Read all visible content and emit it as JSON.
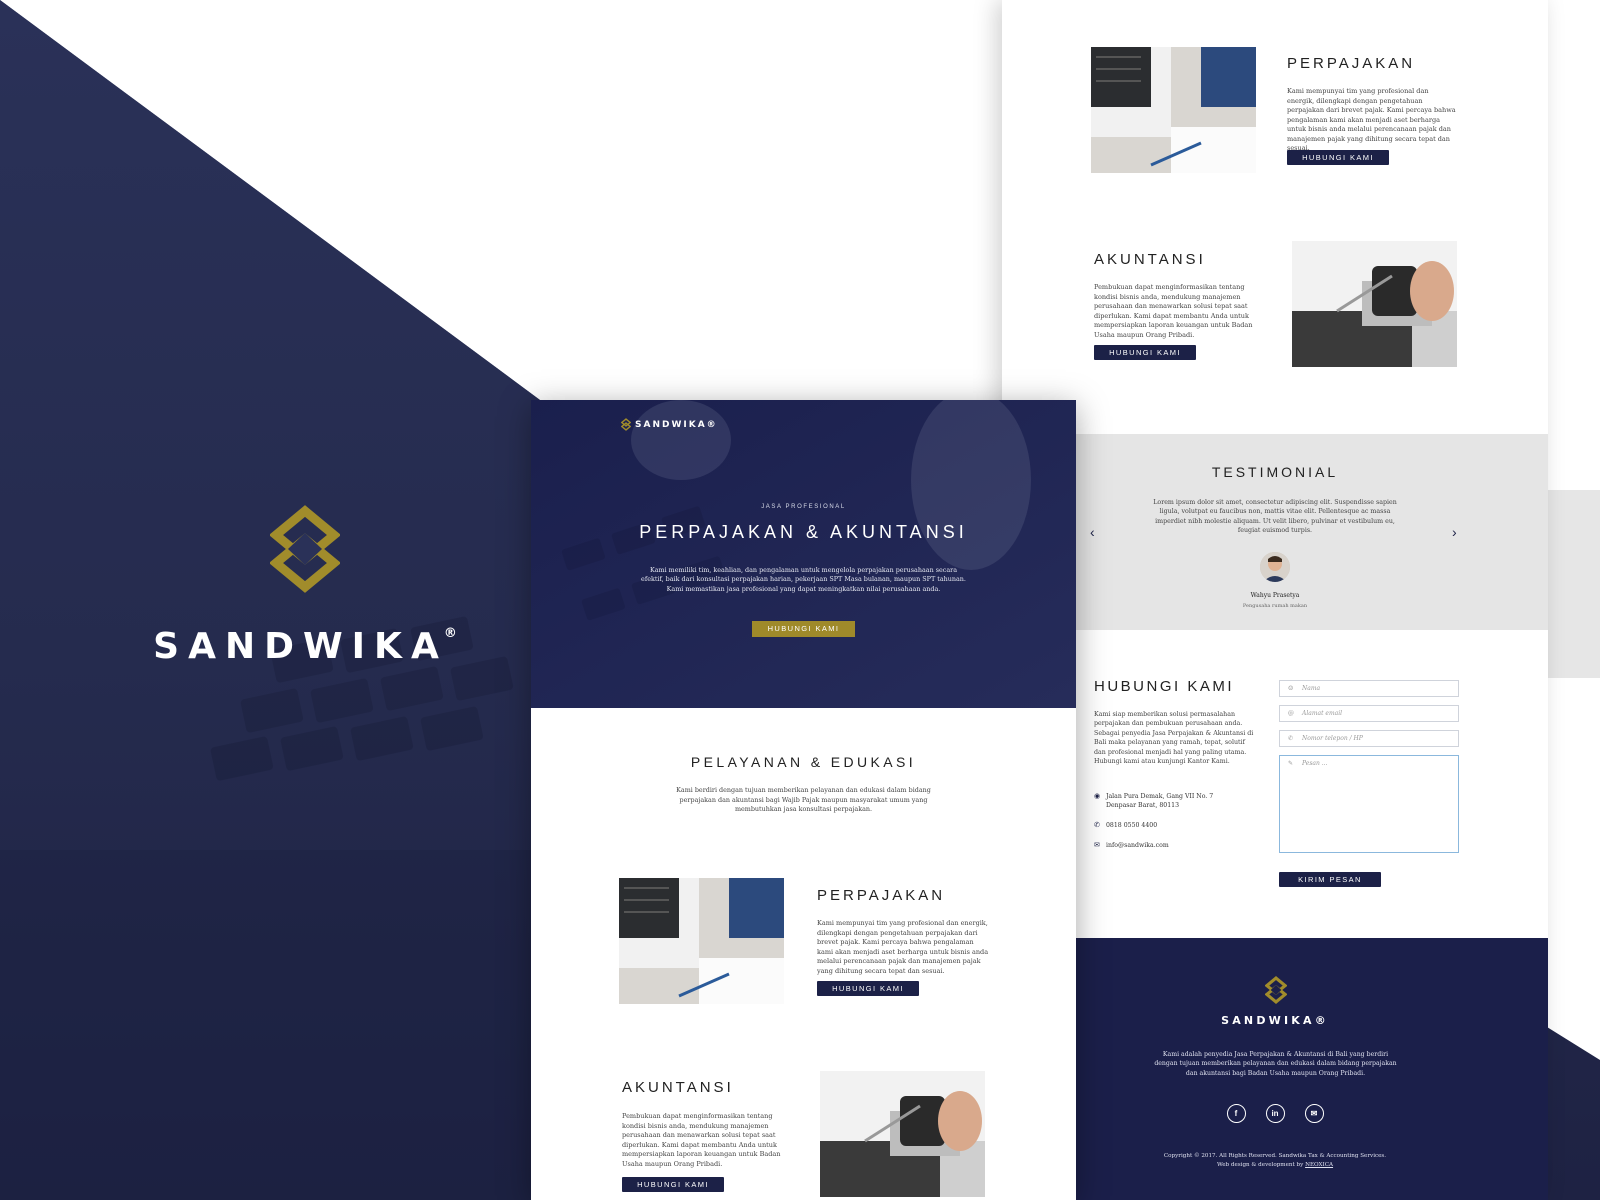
{
  "brand": {
    "name": "SANDWIKA",
    "registered": "®"
  },
  "colors": {
    "navy": "#1b2150",
    "gold": "#9f8a2a",
    "gray_section": "#e5e5e5"
  },
  "hero": {
    "logo_text": "SANDWIKA®",
    "kicker": "JASA PROFESIONAL",
    "title": "PERPAJAKAN & AKUNTANSI",
    "subtitle": "Kami memiliki tim, keahlian, dan pengalaman untuk mengelola perpajakan perusahaan secara efektif, baik dari konsultasi perpajakan harian, pekerjaan SPT Masa bulanan, maupun SPT tahunan. Kami memastikan jasa profesional yang dapat meningkatkan nilai perusahaan anda.",
    "cta": "HUBUNGI KAMI"
  },
  "services_intro": {
    "title": "PELAYANAN & EDUKASI",
    "text": "Kami berdiri dengan tujuan memberikan pelayanan dan edukasi dalam bidang perpajakan dan akuntansi bagi Wajib Pajak maupun masyarakat umum yang membutuhkan jasa konsultasi perpajakan."
  },
  "services": [
    {
      "title": "PERPAJAKAN",
      "text": "Kami mempunyai tim yang profesional dan energik, dilengkapi dengan pengetahuan perpajakan dari brevet pajak. Kami percaya bahwa pengalaman kami akan menjadi aset berharga untuk bisnis anda melalui perencanaan pajak dan manajemen pajak yang dihitung secara tepat dan sesuai.",
      "button": "HUBUNGI KAMI"
    },
    {
      "title": "AKUNTANSI",
      "text": "Pembukuan dapat menginformasikan tentang kondisi bisnis anda, mendukung manajemen perusahaan dan menawarkan solusi tepat saat diperlukan. Kami dapat membantu Anda untuk mempersiapkan laporan keuangan untuk Badan Usaha maupun Orang Pribadi.",
      "button": "HUBUNGI KAMI"
    }
  ],
  "testimonial": {
    "title": "TESTIMONIAL",
    "text": "Lorem ipsum dolor sit amet, consectetur adipiscing elit. Suspendisse sapien ligula, volutpat eu faucibus non, mattis vitae elit. Pellentesque ac massa imperdiet nibh molestie aliquam. Ut velit libero, pulvinar et vestibulum eu, feugiat euismod turpis.",
    "prev": "‹",
    "next": "›",
    "name": "Wahyu Prasetya",
    "role": "Pengusaha rumah makan"
  },
  "contact": {
    "title": "HUBUNGI KAMI",
    "text": "Kami siap memberikan solusi permasalahan perpajakan dan pembukuan perusahaan anda. Sebagai penyedia Jasa Perpajakan & Akuntansi di Bali maka pelayanan yang ramah, tepat, solutif dan profesional menjadi hal yang paling utama. Hubungi kami atau kunjungi Kantor Kami.",
    "address_line1": "Jalan Pura Demak, Gang VII No. 7",
    "address_line2": "Denpasar Barat, 80113",
    "phone": "0818 0550 4400",
    "email": "info@sandwika.com",
    "form": {
      "name_placeholder": "Nama",
      "email_placeholder": "Alamat email",
      "phone_placeholder": "Nomor telepon / HP",
      "message_placeholder": "Pesan ...",
      "submit": "KIRIM PESAN"
    }
  },
  "footer": {
    "brand": "SANDWIKA®",
    "text": "Kami adalah penyedia Jasa Perpajakan & Akuntansi di Bali yang berdiri dengan tujuan memberikan pelayanan dan edukasi dalam bidang perpajakan dan akuntansi bagi Badan Usaha maupun Orang Pribadi.",
    "social": [
      "facebook-icon",
      "linkedin-icon",
      "mail-icon"
    ],
    "copyright": "Copyright © 2017. All Rights Reserved. Sandwika Tax & Accounting Services.",
    "credit_prefix": "Web design & development by",
    "credit_link": "NEOXICA"
  }
}
